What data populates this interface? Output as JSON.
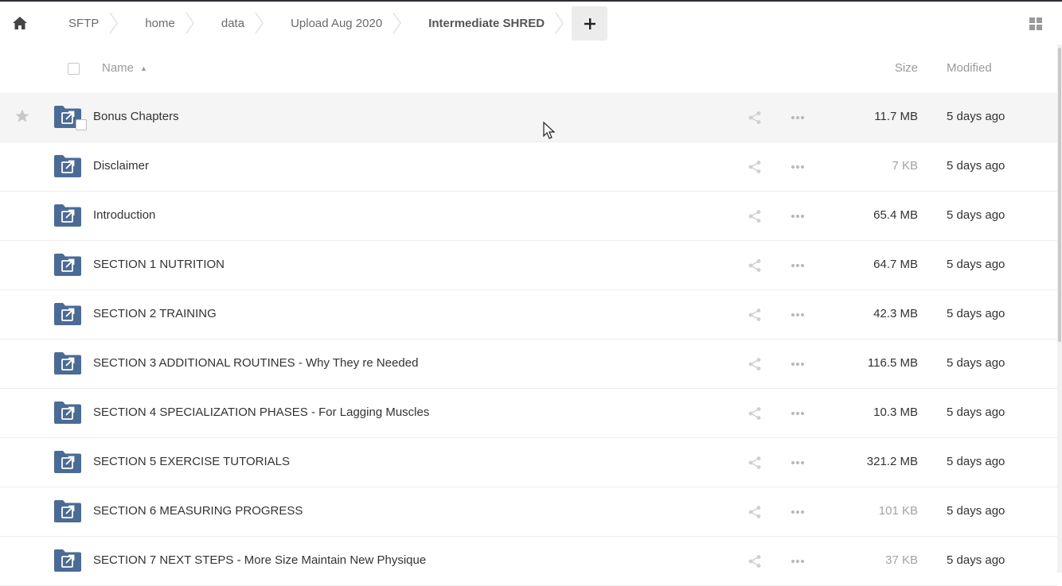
{
  "breadcrumbs": [
    {
      "label": "SFTP"
    },
    {
      "label": "home"
    },
    {
      "label": "data"
    },
    {
      "label": "Upload Aug 2020"
    },
    {
      "label": "Intermediate SHRED"
    }
  ],
  "toolbar": {
    "add_label": "+"
  },
  "header": {
    "name": "Name",
    "size": "Size",
    "modified": "Modified",
    "sort": "ascending"
  },
  "files": [
    {
      "name": "Bonus Chapters",
      "size": "11.7 MB",
      "modified": "5 days ago"
    },
    {
      "name": "Disclaimer",
      "size": "7 KB",
      "modified": "5 days ago"
    },
    {
      "name": "Introduction",
      "size": "65.4 MB",
      "modified": "5 days ago"
    },
    {
      "name": "SECTION 1 NUTRITION",
      "size": "64.7 MB",
      "modified": "5 days ago"
    },
    {
      "name": "SECTION 2 TRAINING",
      "size": "42.3 MB",
      "modified": "5 days ago"
    },
    {
      "name": "SECTION 3 ADDITIONAL ROUTINES - Why They re Needed",
      "size": "116.5 MB",
      "modified": "5 days ago"
    },
    {
      "name": "SECTION 4 SPECIALIZATION PHASES - For Lagging Muscles",
      "size": "10.3 MB",
      "modified": "5 days ago"
    },
    {
      "name": "SECTION 5 EXERCISE TUTORIALS",
      "size": "321.2 MB",
      "modified": "5 days ago"
    },
    {
      "name": "SECTION 6 MEASURING PROGRESS",
      "size": "101 KB",
      "modified": "5 days ago"
    },
    {
      "name": "SECTION 7 NEXT STEPS - More Size Maintain New Physique",
      "size": "37 KB",
      "modified": "5 days ago"
    }
  ],
  "colors": {
    "folder": "#4a6b95",
    "icon_gray": "#cfcfcf",
    "text": "#333333",
    "muted": "#9a9a9a"
  },
  "icons": {
    "home": "home-icon",
    "folder": "external-folder-icon",
    "share": "share-icon",
    "more": "more-icon",
    "star": "star-icon",
    "grid": "grid-view-icon"
  }
}
